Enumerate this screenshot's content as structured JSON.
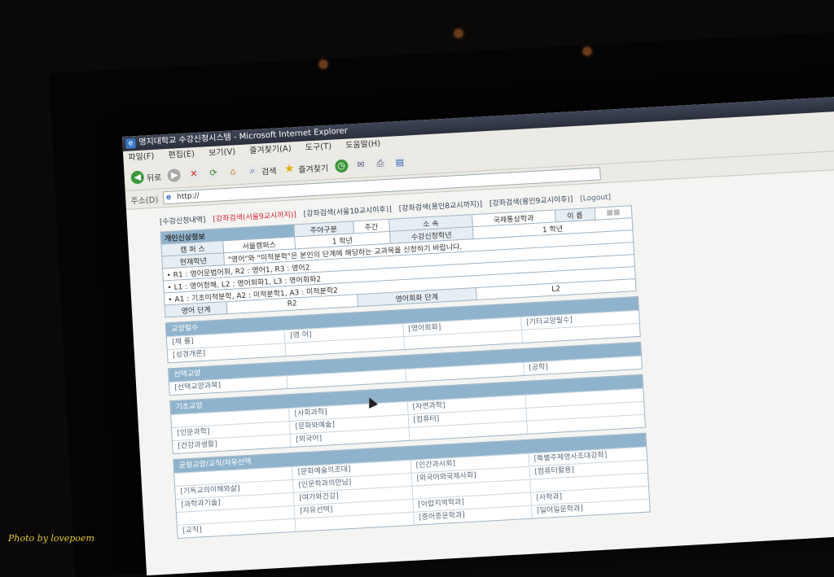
{
  "window": {
    "title": "명지대학교 수강신청시스템 - Microsoft Internet Explorer"
  },
  "menu": [
    "파일(F)",
    "편집(E)",
    "보기(V)",
    "즐겨찾기(A)",
    "도구(T)",
    "도움말(H)"
  ],
  "toolbar": {
    "back": "뒤로",
    "search": "검색",
    "favorites": "즐겨찾기"
  },
  "address": {
    "label": "주소(D)",
    "value": "http://"
  },
  "links": {
    "history": "[수강신청내역]",
    "search_seoul9": "[강좌검색(서울9교시까지)]",
    "search_seoul10": "[강좌검색(서울10교시이후)]",
    "search_yongin8": "[강좌검색(용인8교시까지)]",
    "search_yongin9": "[강좌검색(용인9교시이후)]",
    "logout": "[Logout]"
  },
  "info": {
    "header": "개인신상정보",
    "campus_label": "캠 퍼 스",
    "campus_value": "서울캠퍼스",
    "daynight_label": "주야구분",
    "daynight_value": "주간",
    "dept_label": "소 속",
    "dept_value": "국제통상학과",
    "name_label": "이 름",
    "grade_label": "현재학년",
    "grade_value": "1 학년",
    "apply_grade_label": "수강신청학년",
    "apply_grade_value": "1 학년",
    "notice": "\"영어\"와 \"미적분학\"은 본인의 단계에 해당하는 교과목을 신청하기 바랍니다.",
    "note1": "• R1 : 영어문법어휘, R2 : 영어1, R3 : 영어2",
    "note2": "• L1 : 영어청해, L2 : 영어회화1, L3 : 영어회화2",
    "note3": "• A1 : 기초미적분학, A2 : 미적분학1, A3 : 미적분학2",
    "english_level_label": "영어 단계",
    "english_level_value": "R2",
    "conv_level_label": "영어회화 단계",
    "conv_level_value": "L2"
  },
  "sections": [
    {
      "title": "교양필수",
      "rows": [
        [
          "[채 플]",
          "[영 어]",
          "[영어회화]",
          "[기타교양필수]"
        ],
        [
          "[성경개론]",
          "",
          "",
          ""
        ]
      ]
    },
    {
      "title": "선택교양",
      "rows": [
        [
          "[선택교양과목]",
          "",
          "",
          "[공학]"
        ]
      ]
    },
    {
      "title": "기초교양",
      "rows": [
        [
          "",
          "[사회과학]",
          "[자연과학]",
          ""
        ],
        [
          "[인문과학]",
          "[문화와예술]",
          "[컴퓨터]",
          ""
        ],
        [
          "[건강과생활]",
          "[외국어]",
          "",
          ""
        ]
      ]
    },
    {
      "title": "균형교양/교직/자유선택",
      "rows": [
        [
          "",
          "[문화예술의조대]",
          "[인간과사회]",
          "[특별주제영사조대강좌]"
        ],
        [
          "[기독교의이해와삶]",
          "[인문학과의만남]",
          "[외국어와국제사회]",
          "[컴퓨터활용]"
        ],
        [
          "[과학과기술]",
          "[여가와건강]",
          "",
          ""
        ],
        [
          "",
          "[자유선택]",
          "[아랍지역학과]",
          "[사학과]"
        ],
        [
          "[교직]",
          "",
          "[중어중문학과]",
          "[일어일문학과]"
        ]
      ]
    }
  ],
  "watermark": "Photo by lovepoem"
}
